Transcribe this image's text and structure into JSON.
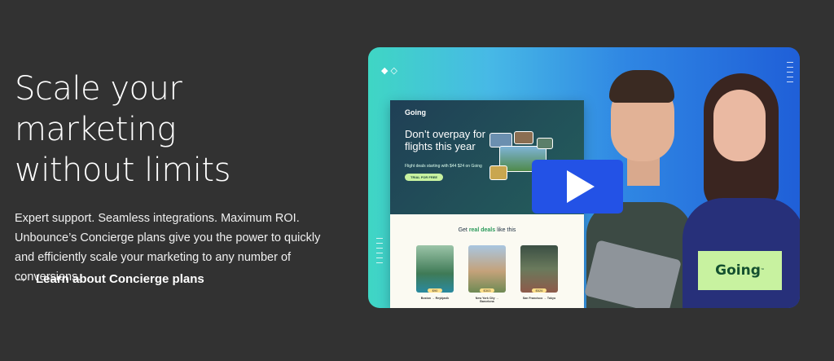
{
  "hero": {
    "title_line1": "Scale your marketing",
    "title_line2": "without limits",
    "description_lines": [
      "Expert support. Seamless integrations. Maximum ROI.",
      "Unbounce’s Concierge plans give you the power to quickly",
      "and efficiently scale your marketing to any number of",
      "conversions."
    ],
    "link_label": "Learn about Concierge plans",
    "link_icon": "arrow-right-icon"
  },
  "media": {
    "play_icon": "play-icon",
    "landing_page": {
      "logo": "Going",
      "headline_line1": "Don’t overpay for",
      "headline_line2": "flights this year",
      "subtext": "Flight deals starting with $44 $24 on Going",
      "button": "TRIAL FOR FREE",
      "deals_prefix": "Get ",
      "deals_highlight": "real deals",
      "deals_suffix": " like this",
      "destinations": [
        {
          "price": "$90",
          "route": "Boston → Reykjavik"
        },
        {
          "price": "$303",
          "route": "New York City → Barcelona"
        },
        {
          "price": "$526",
          "route": "San Francisco → Tokyo"
        }
      ]
    },
    "badge_logo": "Going",
    "badge_tm": "™",
    "colors": {
      "play_button": "#2352e6",
      "badge": "#c8f2a0",
      "page_bg": "#323232"
    }
  }
}
